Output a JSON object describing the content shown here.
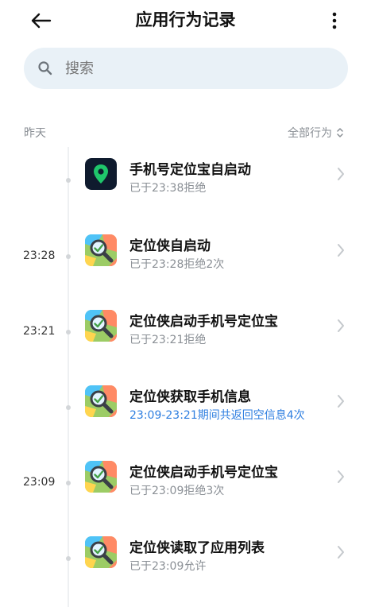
{
  "header": {
    "title": "应用行为记录",
    "back_icon": "back-arrow-icon",
    "more_icon": "more-vertical-icon"
  },
  "search": {
    "placeholder": "搜索",
    "icon": "search-icon"
  },
  "section": {
    "day_label": "昨天",
    "filter_label": "全部行为"
  },
  "colors": {
    "accent_blue": "#2f7fe0",
    "search_bg": "#e9f1f7",
    "muted_text": "#8a8f95"
  },
  "records": [
    {
      "time": "",
      "app_icon": "location-pin-app-icon",
      "title": "手机号定位宝自启动",
      "detail": "已于23:38拒绝",
      "highlight": false
    },
    {
      "time": "23:28",
      "app_icon": "map-magnifier-app-icon",
      "title": "定位侠自启动",
      "detail": "已于23:28拒绝2次",
      "highlight": false
    },
    {
      "time": "23:21",
      "app_icon": "map-magnifier-app-icon",
      "title": "定位侠启动手机号定位宝",
      "detail": "已于23:21拒绝",
      "highlight": false
    },
    {
      "time": "",
      "app_icon": "map-magnifier-app-icon",
      "title": "定位侠获取手机信息",
      "detail": "23:09-23:21期间共返回空信息4次",
      "highlight": true
    },
    {
      "time": "23:09",
      "app_icon": "map-magnifier-app-icon",
      "title": "定位侠启动手机号定位宝",
      "detail": "已于23:09拒绝3次",
      "highlight": false
    },
    {
      "time": "",
      "app_icon": "map-magnifier-app-icon",
      "title": "定位侠读取了应用列表",
      "detail": "已于23:09允许",
      "highlight": false
    }
  ]
}
